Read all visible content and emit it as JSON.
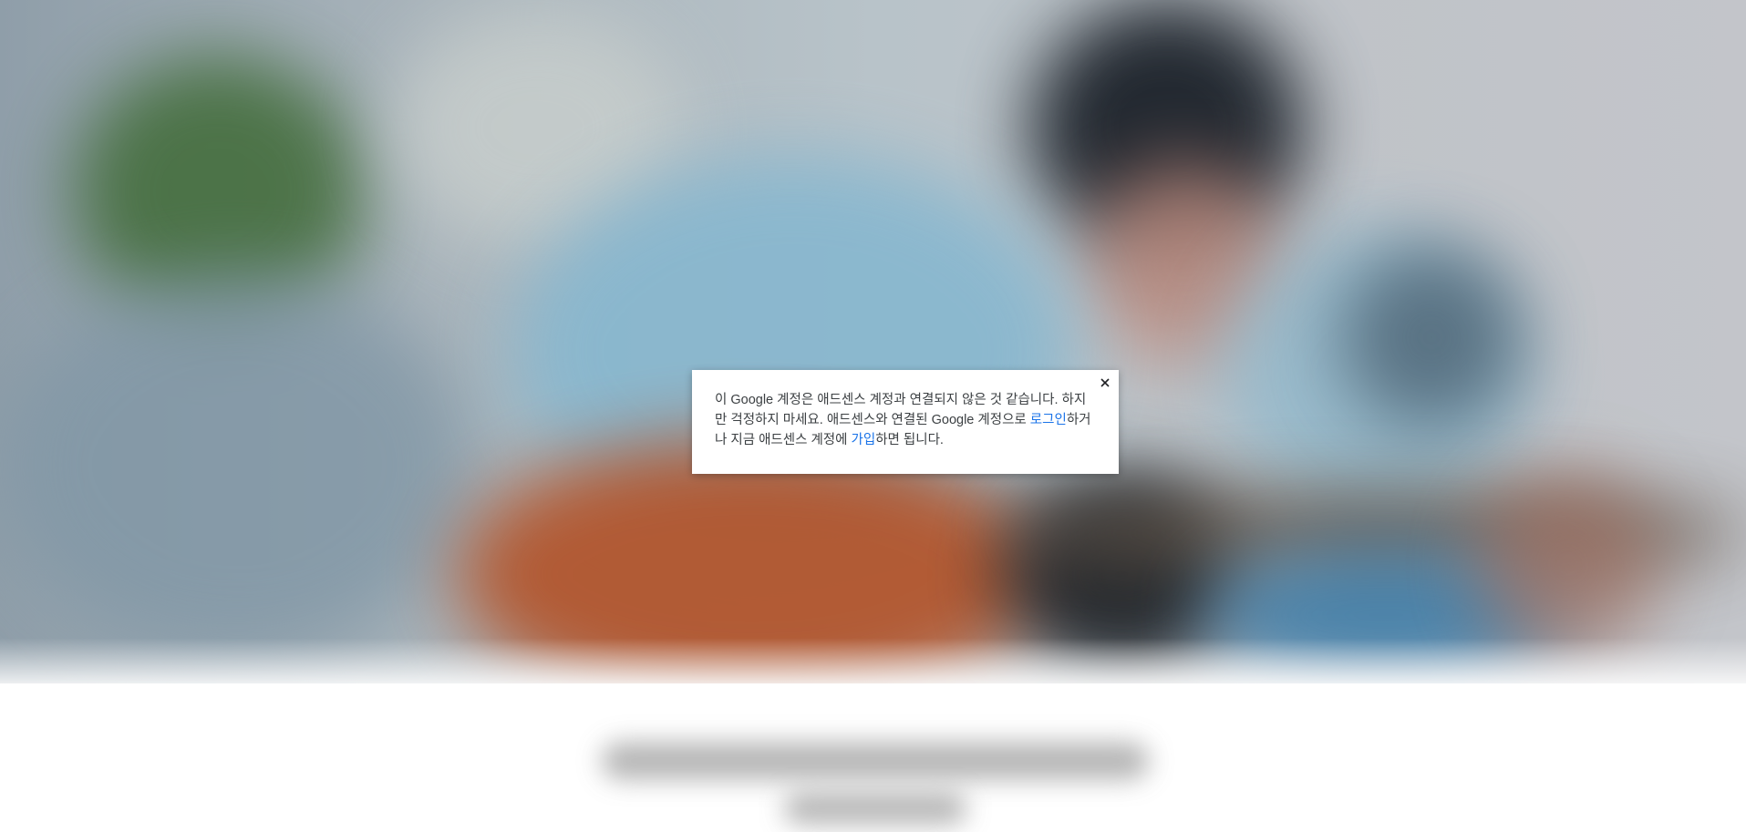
{
  "dialog": {
    "message_part1": "이 Google 계정은 애드센스 계정과 연결되지 않은 것 같습니다. 하지만 걱정하지 마세요. 애드센스와 연결된 Google 계정으로 ",
    "login_link": "로그인",
    "message_part2": "하거나 지금 애드센스 계정에 ",
    "signup_link": "가입",
    "message_part3": "하면 됩니다.",
    "close_icon": "close-icon"
  },
  "colors": {
    "link": "#1a73e8",
    "text": "#3c4043"
  }
}
